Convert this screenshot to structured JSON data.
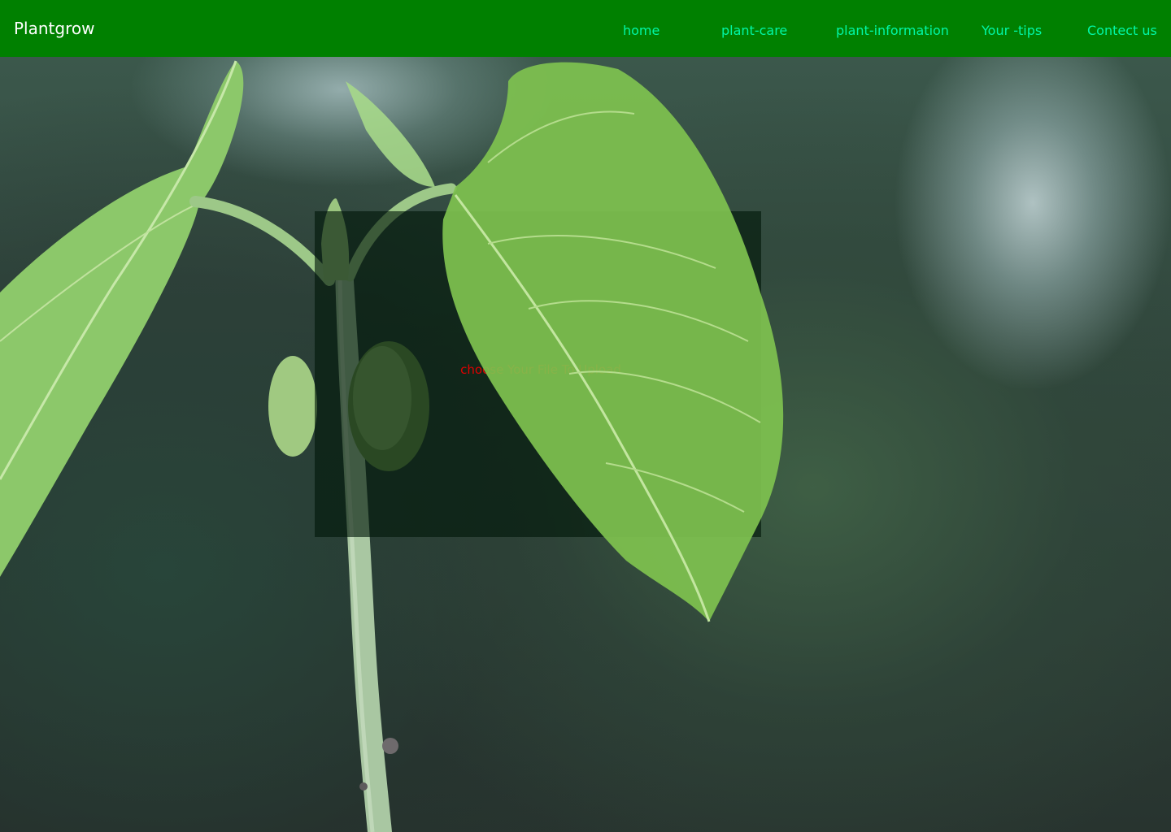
{
  "navbar": {
    "brand": "Plantgrow",
    "links": [
      {
        "label": "home"
      },
      {
        "label": "plant-care"
      },
      {
        "label": "plant-information"
      },
      {
        "label": "Your -tips"
      },
      {
        "label": "Contect us"
      }
    ]
  },
  "upload": {
    "label": "choose Your File To Upload"
  },
  "colors": {
    "navbar_background": "#008000",
    "brand_text": "#ffffff",
    "nav_link_text": "#00f7a6",
    "upload_label_text": "#e00000"
  }
}
